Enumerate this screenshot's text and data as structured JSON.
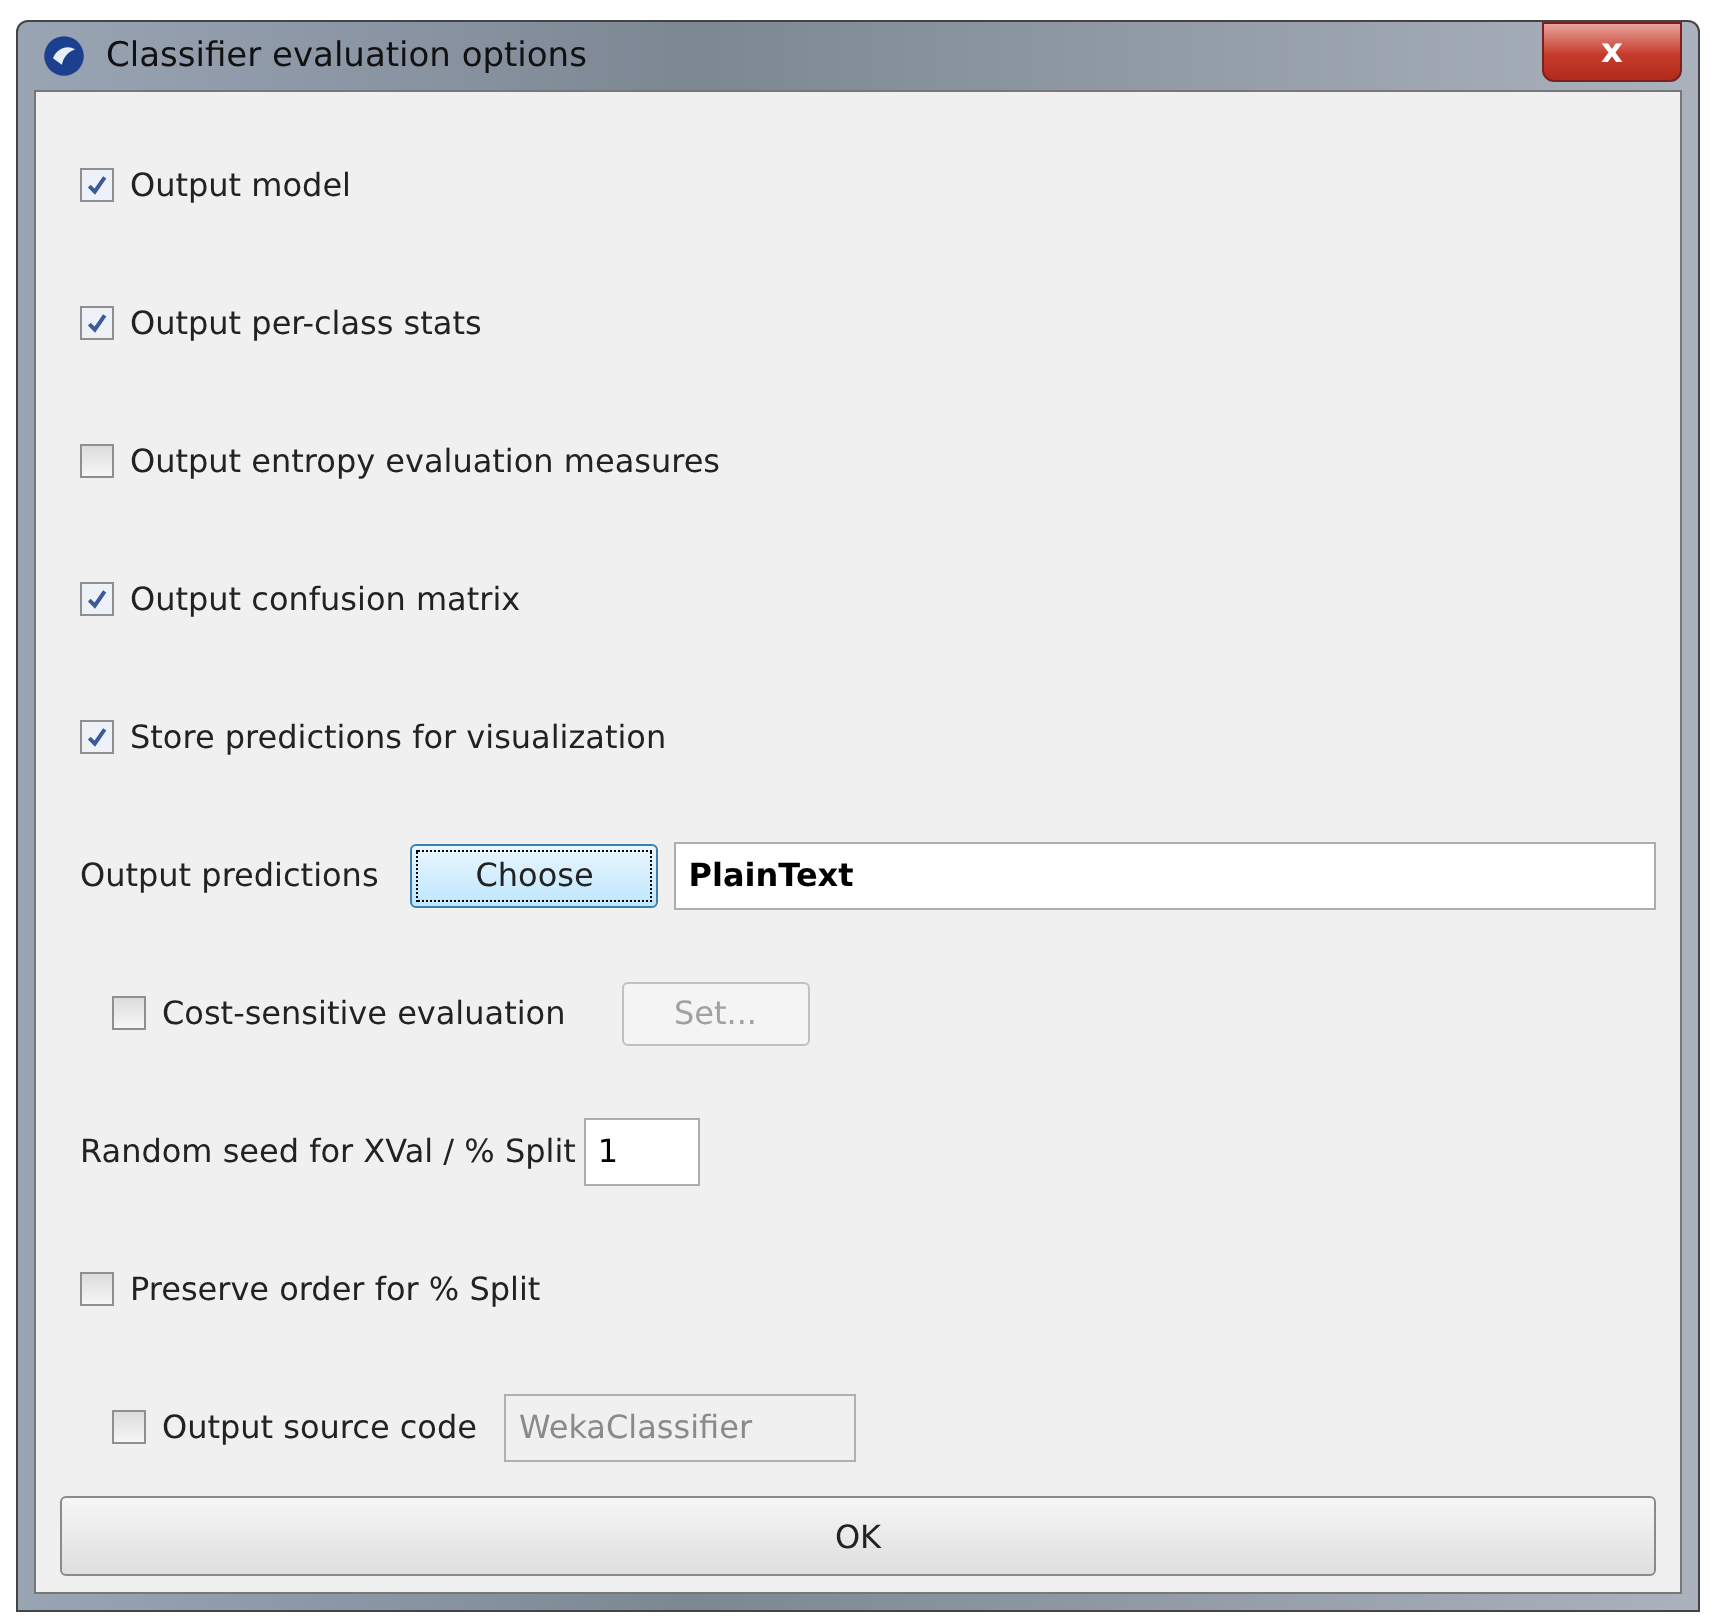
{
  "window": {
    "title": "Classifier evaluation options",
    "close_label": "x"
  },
  "options": [
    {
      "label": "Output model",
      "checked": true
    },
    {
      "label": "Output per-class stats",
      "checked": true
    },
    {
      "label": "Output entropy evaluation measures",
      "checked": false
    },
    {
      "label": "Output confusion matrix",
      "checked": true
    },
    {
      "label": "Store predictions for visualization",
      "checked": true
    }
  ],
  "output_predictions": {
    "label": "Output predictions",
    "button": {
      "label": "Choose",
      "focused": true
    },
    "value": "PlainText"
  },
  "cost_sensitive": {
    "label": "Cost-sensitive evaluation",
    "checked": false,
    "button": {
      "label": "Set...",
      "disabled": true
    }
  },
  "random_seed": {
    "label": "Random seed for XVal / % Split",
    "value": "1"
  },
  "preserve_order": {
    "label": "Preserve order for % Split",
    "checked": false
  },
  "source_code": {
    "label": "Output source code",
    "checked": false,
    "field": {
      "value": "WekaClassifier",
      "disabled": true
    }
  },
  "ok_button": "OK"
}
